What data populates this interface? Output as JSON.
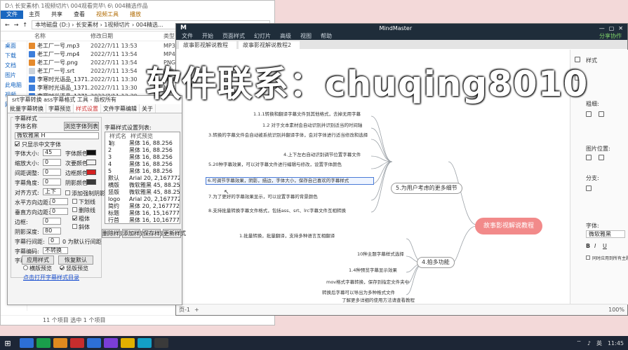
{
  "watermark": "软件联系：chuqing8010",
  "explorer": {
    "window_title": "D:\\ 长安素材\\ 1视频切片\\ 004观看完毕\\ 6\\ 004精选作品",
    "tabs": [
      "文件",
      "主页",
      "共享",
      "查看",
      "视频工具"
    ],
    "active_tab_group": "播放",
    "address": "本地磁盘 (D:) › 长安素材 › 1视频切片 › 004精选...",
    "columns": [
      "名称",
      "修改日期",
      "类型"
    ],
    "sidebar": [
      "桌面",
      "下载",
      "文档",
      "图片",
      "此电脑",
      "视频",
      "网络"
    ],
    "files": [
      {
        "name": "老工厂一号.mp3",
        "date": "2022/7/11 13:53",
        "type": "MP3 文件",
        "icon": "png"
      },
      {
        "name": "老工厂一号.mp4",
        "date": "2022/7/11 13:54",
        "type": "MP4 文件",
        "icon": "vid"
      },
      {
        "name": "老工厂一号.png",
        "date": "2022/7/11 13:54",
        "type": "PNG 图片文件",
        "icon": "png"
      },
      {
        "name": "老工厂一号.srt",
        "date": "2022/7/11 13:54",
        "type": "文本文档",
        "icon": "txt"
      },
      {
        "name": "李寒时光语品_1371...",
        "date": "2022/7/11 13:30",
        "type": "MP4 文件",
        "icon": "vid"
      },
      {
        "name": "李寒时光语品_1371...",
        "date": "2022/7/11 13:30",
        "type": "MP4 文件",
        "icon": "vid"
      },
      {
        "name": "李寒时光语品_1371...",
        "date": "2022/7/11 13:30",
        "type": "MP4 文件",
        "icon": "vid"
      },
      {
        "name": "李寒时光语品_1371...",
        "date": "2022/7/11 13:30",
        "type": "MP4 文件",
        "icon": "vid"
      },
      {
        "name": "李寒时光语品_1371...",
        "date": "2022/7/11 13:30",
        "type": "MP4 文件",
        "icon": "vid"
      },
      {
        "name": "李寒时光语品_1371...",
        "date": "2022/7/11 13:30",
        "type": "MP4 文件",
        "icon": "vid"
      },
      {
        "name": "李寒时光语品_1371...",
        "date": "2022/7/11 13:30",
        "type": "MP4 文件",
        "icon": "vid"
      }
    ],
    "status": "11 个项目    选中 1 个项目"
  },
  "dialog": {
    "title": "srt字幕转换 ass字幕格式 工具 - 版权所有",
    "tabs": [
      "批量字幕转换",
      "字幕预览",
      "样式设置",
      "文件字幕编辑",
      "关于"
    ],
    "active_tab": "样式设置",
    "section_label": "字幕样式",
    "font_label": "字体名称",
    "font_value": "微软雅黑 H",
    "more_fonts": "浏览字体列表",
    "bold_label": "只显示中文字体",
    "font_size_label": "字体大小:",
    "font_size": "45",
    "scale_x_label": "缩放大小:",
    "scale_x": "0",
    "spacing_label": "间距调整:",
    "spacing": "0",
    "rotate_label": "字幕角度:",
    "rotate": "0",
    "align_label": "对齐方式:",
    "align_value": "上下",
    "h_margin_label": "水平方向边距:",
    "h_margin": "0",
    "v_margin_label": "垂直方向边距:",
    "v_margin": "0",
    "outline_label": "边框:",
    "outline": "0",
    "shadow_label": "阴影深度:",
    "shadow": "80",
    "color_label1": "字体颜色:",
    "color_label2": "次要颜色:",
    "color_label3": "边框颜色:",
    "color_label4": "阴影颜色:",
    "swatch_colors": [
      "#111111",
      "#f2f2f2",
      "#d42020",
      "#3a3a3a"
    ],
    "opt_labels": [
      "添加强制阴影",
      "下划线",
      "删除线",
      "粗体",
      "斜体"
    ],
    "opt_checked": [
      false,
      false,
      false,
      true,
      false
    ],
    "line_label": "字幕行间距:",
    "line_value": "0",
    "line_tail": "0 为默认行间距",
    "encoding_label": "字幕编码:",
    "encoding_value": "不转换",
    "preview_label": "字幕预览:",
    "preview_opts": [
      "横版预览",
      "竖版预览"
    ],
    "btn_apply": "应用样式",
    "btn_restore": "恢复默认",
    "list_title": "字幕样式设置列表:",
    "list_cols": [
      "样式名称",
      "样式预览"
    ],
    "list_rows": [
      {
        "a": "1",
        "b": "黑体 16, 88.256"
      },
      {
        "a": "2",
        "b": "黑体 16, 88.256"
      },
      {
        "a": "3",
        "b": "黑体 16, 88.256"
      },
      {
        "a": "4",
        "b": "黑体 16, 88.256"
      },
      {
        "a": "5",
        "b": "黑体 16, 88.256"
      },
      {
        "a": "默认",
        "b": "Arial 20, 2,16777215"
      },
      {
        "a": "横版",
        "b": "微软雅黑 45, 88.256"
      },
      {
        "a": "竖版",
        "b": "微软雅黑 45, 88.256"
      },
      {
        "a": "logo",
        "b": "Arial 20, 2,16777215"
      },
      {
        "a": "简约",
        "b": "黑体 20, 2,16777215"
      },
      {
        "a": "标题",
        "b": "黑体 16, 15,16777215"
      },
      {
        "a": "行首",
        "b": "黑体 16, 10,16777215"
      }
    ],
    "list_btns": [
      "删除样式",
      "添加样式",
      "保存样式",
      "更新样式"
    ],
    "link": "点击打开字幕样式目录"
  },
  "mindmaster": {
    "app_name": "MindMaster",
    "menu": [
      "文件",
      "开始",
      "页面样式",
      "幻灯片",
      "高级",
      "视图",
      "帮助"
    ],
    "share_label": "分享协作",
    "doc_tabs": [
      "故事影视解说教程",
      "故事影视解说教程2"
    ],
    "central": "故事影视解说教程",
    "branch_1": "5.为用户考虑的更多细节",
    "branch_2": "4.拍多功能",
    "nodes_1": [
      "1.1.1转换和翻译字幕文件到其他格式，去掉无用字幕",
      "1.2 对于文本素材会自动识别并识别适当的时间轴",
      "3.转换的字幕文件会自动被系统识别并翻译字体，会对字体进行适当修改和选择",
      "4.上下左右自动识别调节位置字幕文件",
      "5.20种字幕效果，可以对字幕文件进行编辑与修改，设置字体颜色",
      "6.可调节字幕效果，阴影，描边，字体大小，保存自己喜欢的字幕样式",
      "7.为了更好的字幕效果显示，可以设置字幕的背景颜色",
      "8.支持批量转换字幕文件格式，包括ass、srt、lrc字幕文件互相转换"
    ],
    "nodes_2": [
      "1.批量转换，批量翻译，支持多种语言互相翻译",
      "10种主题字幕样式选择",
      "1.4种预览字幕显示效果",
      "mov格式字幕转换，保存到指定文件夹中",
      "转换后字幕可以导出为多种格式文件",
      "了解更多详细的使用方法请查看教程"
    ],
    "panel": {
      "title": "样式",
      "bold_label": "粗细:",
      "img_label": "图片位置:",
      "layout_label": "分支:",
      "font_label": "字体:",
      "font_value": "微软雅黑",
      "check_label": "同时应用到所有主题"
    },
    "status_text": "页-1",
    "zoom": "100%"
  },
  "taskbar": {
    "start": "⊞",
    "apps": [
      "#2d6fd6",
      "#1a9e4b",
      "#e08a1f",
      "#c62d2d",
      "#2d6fd6",
      "#7a3ed8",
      "#e1b000",
      "#13a0c7",
      "#3a3a3a"
    ],
    "clock": "11:45",
    "lang": "英"
  }
}
